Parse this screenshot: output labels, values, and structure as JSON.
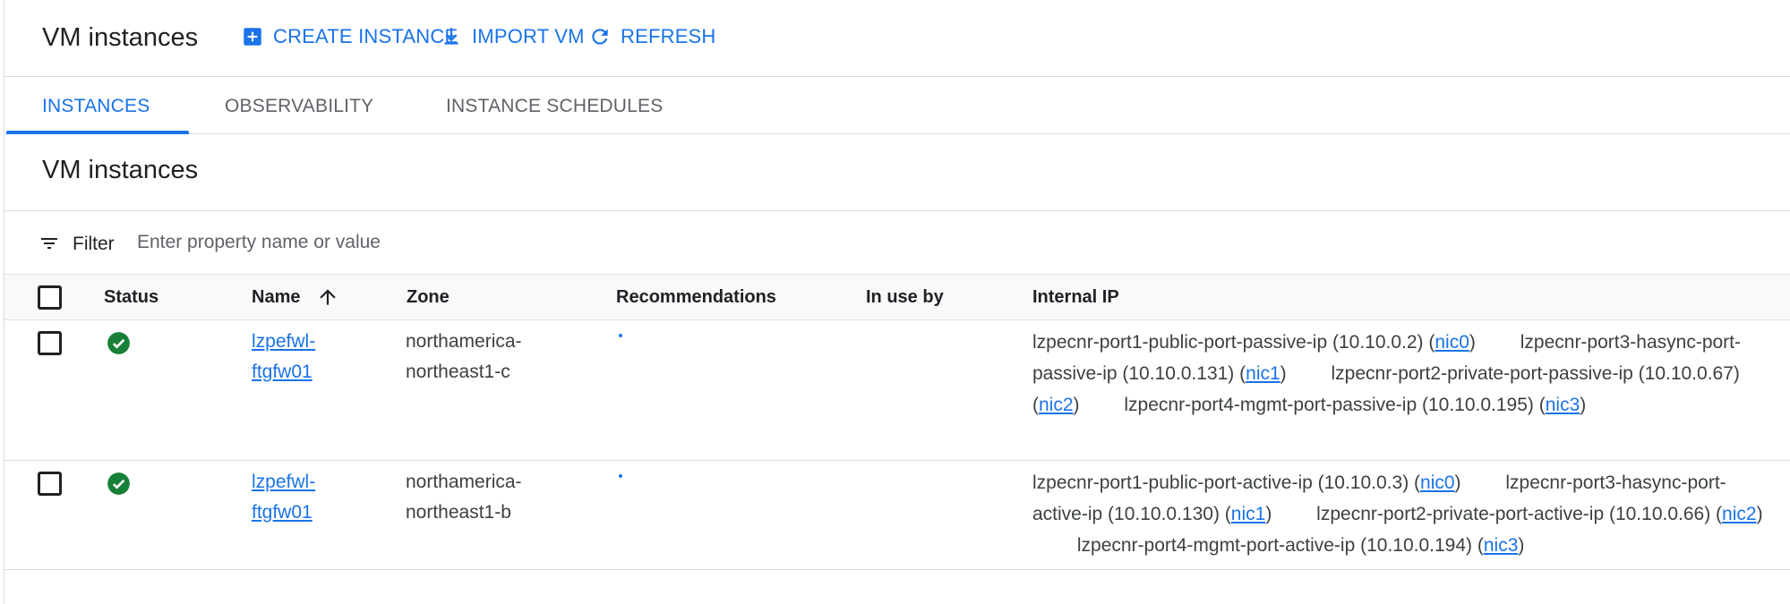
{
  "header": {
    "title": "VM instances",
    "actions": [
      {
        "label": "CREATE INSTANCE",
        "icon": "add-box-icon"
      },
      {
        "label": "IMPORT VM",
        "icon": "download-icon"
      },
      {
        "label": "REFRESH",
        "icon": "refresh-icon"
      }
    ]
  },
  "tabs": [
    {
      "label": "INSTANCES",
      "active": true
    },
    {
      "label": "OBSERVABILITY",
      "active": false
    },
    {
      "label": "INSTANCE SCHEDULES",
      "active": false
    }
  ],
  "section": {
    "title": "VM instances"
  },
  "filter": {
    "label": "Filter",
    "placeholder": "Enter property name or value"
  },
  "table": {
    "columns": [
      "Status",
      "Name",
      "Zone",
      "Recommendations",
      "In use by",
      "Internal IP"
    ],
    "sort": {
      "column": "Name",
      "direction": "ascending"
    },
    "rows": [
      {
        "status": "running",
        "name": "lzpefwl-ftgfw01",
        "name_lines": [
          "lzpefwl-",
          "ftgfw01"
        ],
        "zone": "northamerica-northeast1-c",
        "zone_lines": [
          "northamerica-",
          "northeast1-c"
        ],
        "in_use_by": "",
        "ips": [
          {
            "text": "lzpecnr-port1-public-port-passive-ip (10.10.0.2)",
            "nic": "nic0"
          },
          {
            "text": "lzpecnr-port3-hasync-port-passive-ip (10.10.0.131)",
            "nic": "nic1"
          },
          {
            "text": "lzpecnr-port2-private-port-passive-ip (10.10.0.67)",
            "nic": "nic2"
          },
          {
            "text": "lzpecnr-port4-mgmt-port-passive-ip (10.10.0.195)",
            "nic": "nic3"
          }
        ]
      },
      {
        "status": "running",
        "name": "lzpefwl-ftgfw01",
        "name_lines": [
          "lzpefwl-",
          "ftgfw01"
        ],
        "zone": "northamerica-northeast1-b",
        "zone_lines": [
          "northamerica-",
          "northeast1-b"
        ],
        "in_use_by": "",
        "ips": [
          {
            "text": "lzpecnr-port1-public-port-active-ip (10.10.0.3)",
            "nic": "nic0"
          },
          {
            "text": "lzpecnr-port3-hasync-port-active-ip (10.10.0.130)",
            "nic": "nic1"
          },
          {
            "text": "lzpecnr-port2-private-port-active-ip (10.10.0.66)",
            "nic": "nic2"
          },
          {
            "text": "lzpecnr-port4-mgmt-port-active-ip (10.10.0.194)",
            "nic": "nic3"
          }
        ]
      }
    ]
  },
  "colors": {
    "accent": "#1a73e8",
    "status_running": "#188038",
    "text": "#202124",
    "muted": "#5f6368",
    "divider": "#dadce0"
  }
}
